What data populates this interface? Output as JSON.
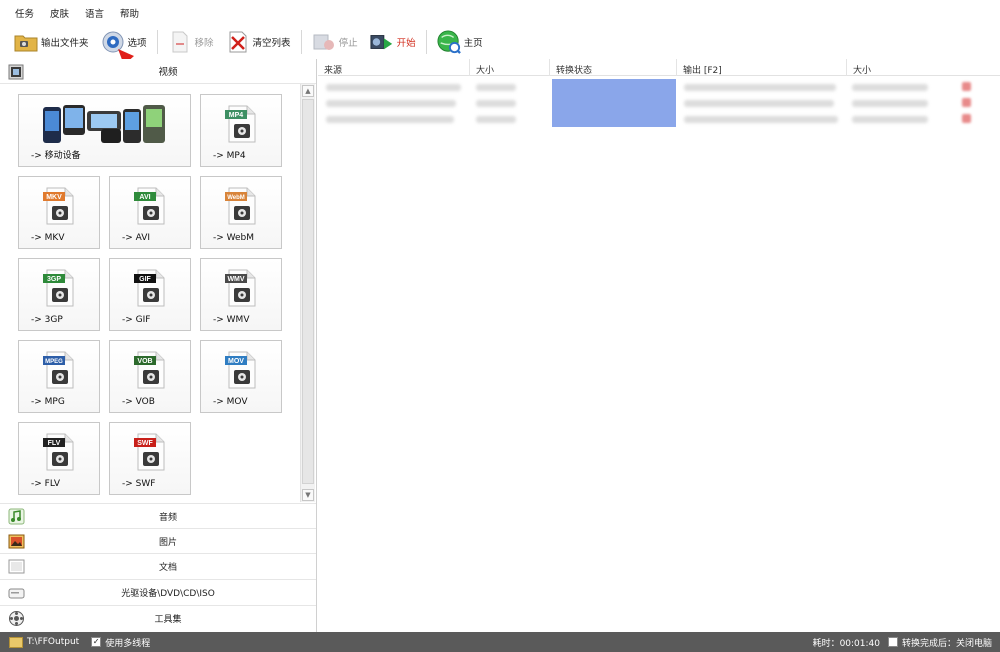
{
  "menu": [
    "任务",
    "皮肤",
    "语言",
    "帮助"
  ],
  "toolbar": {
    "output_folder": "输出文件夹",
    "options": "选项",
    "remove": "移除",
    "clear_list": "清空列表",
    "stop": "停止",
    "start": "开始",
    "home": "主页"
  },
  "left": {
    "video_header": "视频",
    "tiles": [
      {
        "label": "-> 移动设备",
        "icon": "mobile-devices-icon"
      },
      {
        "label": "-> MP4",
        "badge": "MP4",
        "icon": "mp4-file-icon"
      },
      {
        "label": "-> MKV",
        "badge": "MKV",
        "icon": "mkv-file-icon"
      },
      {
        "label": "-> AVI",
        "badge": "AVI",
        "icon": "avi-file-icon"
      },
      {
        "label": "-> WebM",
        "badge": "WebM",
        "icon": "webm-file-icon"
      },
      {
        "label": "-> 3GP",
        "badge": "3GP",
        "icon": "3gp-file-icon"
      },
      {
        "label": "-> GIF",
        "badge": "GIF",
        "icon": "gif-file-icon"
      },
      {
        "label": "-> WMV",
        "badge": "WMV",
        "icon": "wmv-file-icon"
      },
      {
        "label": "-> MPG",
        "badge": "MPEG",
        "icon": "mpg-file-icon"
      },
      {
        "label": "-> VOB",
        "badge": "VOB",
        "icon": "vob-file-icon"
      },
      {
        "label": "-> MOV",
        "badge": "MOV",
        "icon": "mov-file-icon"
      },
      {
        "label": "-> FLV",
        "badge": "FLV",
        "icon": "flv-file-icon"
      },
      {
        "label": "-> SWF",
        "badge": "SWF",
        "icon": "swf-file-icon"
      }
    ],
    "categories": [
      {
        "label": "音频",
        "icon": "audio-icon"
      },
      {
        "label": "图片",
        "icon": "picture-icon"
      },
      {
        "label": "文档",
        "icon": "document-icon"
      },
      {
        "label": "光驱设备\\DVD\\CD\\ISO",
        "icon": "optical-drive-icon"
      },
      {
        "label": "工具集",
        "icon": "toolbox-icon"
      }
    ]
  },
  "table": {
    "columns": [
      "来源",
      "大小",
      "转换状态",
      "输出 [F2]",
      "大小"
    ]
  },
  "status": {
    "output_path": "T:\\FFOutput",
    "multithread_label": "使用多线程",
    "elapsed": "耗时：00:01:40",
    "after_convert": "转换完成后：关闭电脑"
  },
  "colors": {
    "accent_start": "#d12a1a",
    "status_bar": "#5a5a5a",
    "status_column": "#8aa6ea",
    "annotation_arrow": "#e0201a"
  }
}
